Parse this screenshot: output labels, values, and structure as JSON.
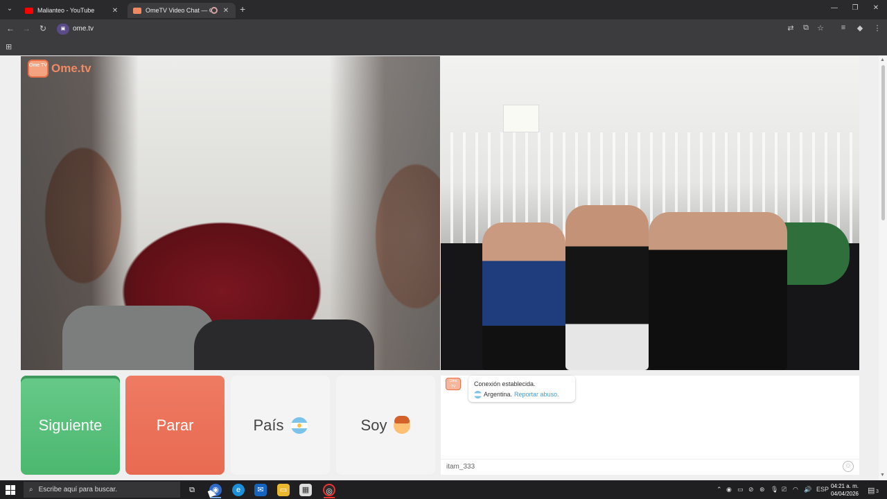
{
  "browser": {
    "tabs": [
      {
        "title": "Malianteo - YouTube",
        "favicon_color": "#ff0000"
      },
      {
        "title": "OmeTV Video Chat — Ome",
        "favicon_color": "#f08a62"
      }
    ],
    "url": "ome.tv"
  },
  "ometv": {
    "logo_small": "Ome TV",
    "logo_text": "Ome.tv",
    "buttons": {
      "next": "Siguiente",
      "stop": "Parar",
      "country": "País",
      "gender": "Soy"
    },
    "chat": {
      "connected": "Conexión establecida.",
      "country": "Argentina.",
      "report": "Reportar abuso.",
      "username": "itam_333"
    },
    "colors": {
      "next": "#5bc07c",
      "stop": "#ea7259",
      "accent": "#f08a62"
    }
  },
  "taskbar": {
    "search_placeholder": "Escribe aquí para buscar.",
    "language": "ESP",
    "time": "04:21 a. m.",
    "date": "04/04/2026",
    "notifications": "3"
  }
}
